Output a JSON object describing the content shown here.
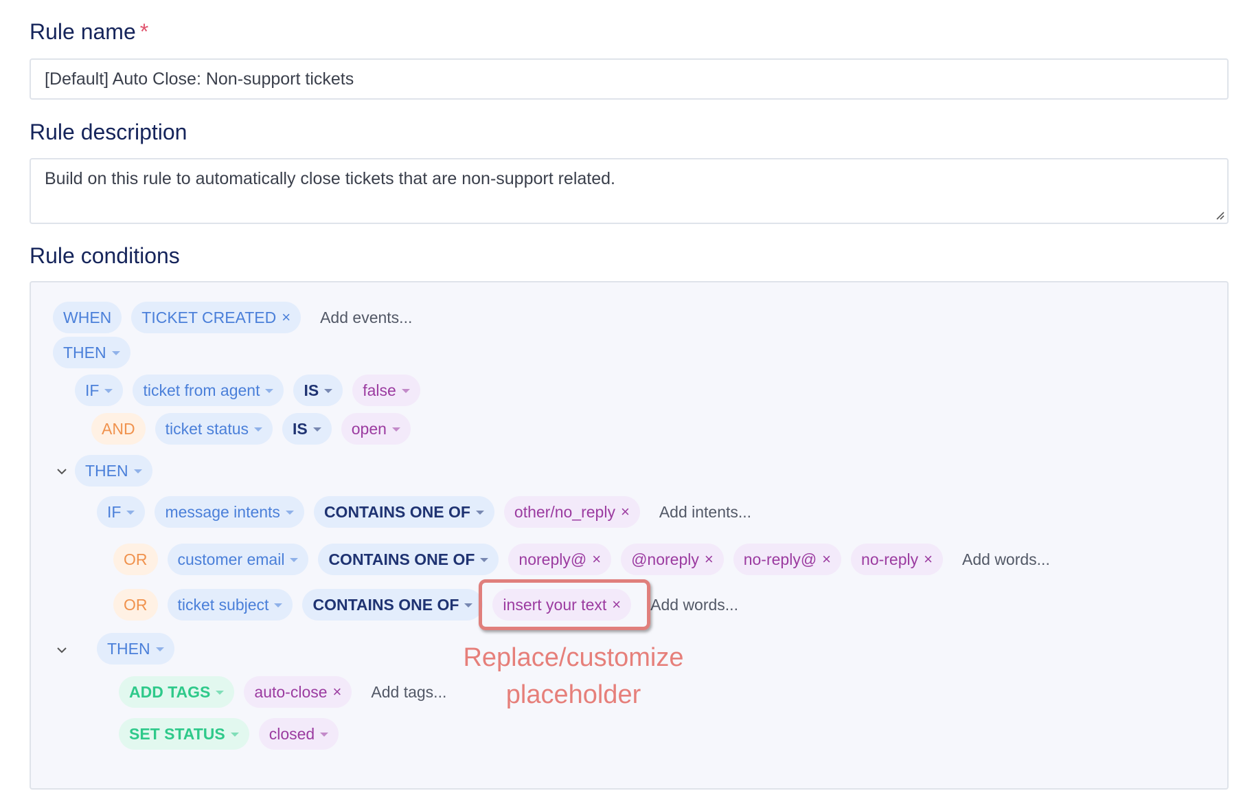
{
  "form": {
    "rule_name_label": "Rule name",
    "required_mark": "*",
    "rule_name_value": "[Default] Auto Close: Non-support tickets",
    "rule_description_label": "Rule description",
    "rule_description_value": "Build on this rule to automatically close tickets that are non-support related.",
    "rule_conditions_label": "Rule conditions"
  },
  "conditions": {
    "when": {
      "keyword": "WHEN",
      "event": "TICKET CREATED",
      "add": "Add events..."
    },
    "then1": {
      "keyword": "THEN"
    },
    "if1": {
      "keyword": "IF",
      "field": "ticket from agent",
      "operator": "IS",
      "value": "false"
    },
    "and1": {
      "keyword": "AND",
      "field": "ticket status",
      "operator": "IS",
      "value": "open"
    },
    "then2": {
      "keyword": "THEN"
    },
    "if2": {
      "keyword": "IF",
      "field": "message intents",
      "operator": "CONTAINS ONE OF",
      "value": "other/no_reply",
      "add": "Add intents..."
    },
    "or1": {
      "keyword": "OR",
      "field": "customer email",
      "operator": "CONTAINS ONE OF",
      "values": [
        "noreply@",
        "@noreply",
        "no-reply@",
        "no-reply"
      ],
      "add": "Add words..."
    },
    "or2": {
      "keyword": "OR",
      "field": "ticket subject",
      "operator": "CONTAINS ONE OF",
      "value": "insert your text",
      "add": "Add words..."
    },
    "then3": {
      "keyword": "THEN"
    },
    "add_tags": {
      "action": "ADD TAGS",
      "value": "auto-close",
      "add": "Add tags..."
    },
    "set_status": {
      "action": "SET STATUS",
      "value": "closed"
    }
  },
  "annotation": {
    "line1": "Replace/customize",
    "line2": "placeholder"
  },
  "colors": {
    "keyword_blue": "#4a7fd9",
    "value_purple": "#9b3ba0",
    "or_orange": "#f0924d",
    "action_green": "#2ec98a",
    "annotation_red": "#e07f7c"
  }
}
